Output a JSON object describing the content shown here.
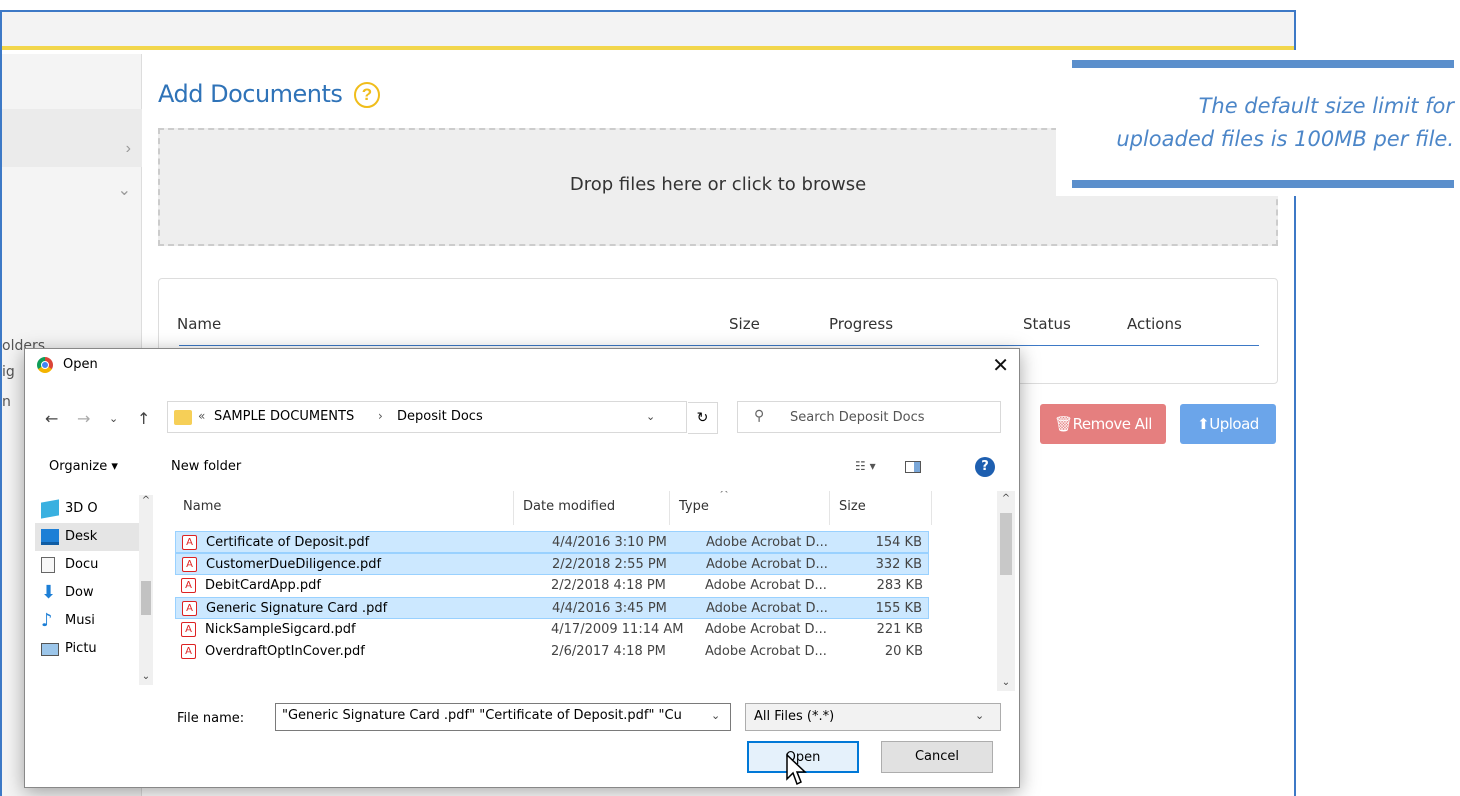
{
  "web": {
    "title": "Add Documents",
    "help_glyph": "?",
    "dropzone_text": "Drop files here or click to browse",
    "columns": [
      "Name",
      "Size",
      "Progress",
      "Status",
      "Actions"
    ],
    "remove_all_label": "Remove All",
    "upload_label": "Upload",
    "nav_partial": [
      "olders",
      "ig",
      "n"
    ],
    "accent_color": "#2f73b8",
    "highlight_color": "#f2d64b"
  },
  "callout": {
    "text_line1": "The default size limit for",
    "text_line2": "uploaded files is 100MB per file."
  },
  "dialog": {
    "title": "Open",
    "breadcrumb": [
      "SAMPLE DOCUMENTS",
      "Deposit Docs"
    ],
    "breadcrumb_prefix": "«",
    "search_placeholder": "Search Deposit Docs",
    "organize_label": "Organize ▾",
    "new_folder_label": "New folder",
    "nav_pane": [
      {
        "label": "3D O",
        "icon": "3d-objects-icon"
      },
      {
        "label": "Desk",
        "icon": "desktop-icon"
      },
      {
        "label": "Docu",
        "icon": "documents-icon"
      },
      {
        "label": "Dow",
        "icon": "downloads-icon"
      },
      {
        "label": "Musi",
        "icon": "music-icon"
      },
      {
        "label": "Pictu",
        "icon": "pictures-icon"
      }
    ],
    "list_headers": {
      "name": "Name",
      "date": "Date modified",
      "type": "Type",
      "size": "Size"
    },
    "files": [
      {
        "name": "Certificate of Deposit.pdf",
        "date": "4/4/2016 3:10 PM",
        "type": "Adobe Acrobat D...",
        "size": "154 KB",
        "selected": true
      },
      {
        "name": "CustomerDueDiligence.pdf",
        "date": "2/2/2018 2:55 PM",
        "type": "Adobe Acrobat D...",
        "size": "332 KB",
        "selected": true
      },
      {
        "name": "DebitCardApp.pdf",
        "date": "2/2/2018 4:18 PM",
        "type": "Adobe Acrobat D...",
        "size": "283 KB",
        "selected": false
      },
      {
        "name": "Generic Signature Card .pdf",
        "date": "4/4/2016 3:45 PM",
        "type": "Adobe Acrobat D...",
        "size": "155 KB",
        "selected": true
      },
      {
        "name": "NickSampleSigcard.pdf",
        "date": "4/17/2009 11:14 AM",
        "type": "Adobe Acrobat D...",
        "size": "221 KB",
        "selected": false
      },
      {
        "name": "OverdraftOptInCover.pdf",
        "date": "2/6/2017 4:18 PM",
        "type": "Adobe Acrobat D...",
        "size": "20 KB",
        "selected": false
      }
    ],
    "filename_label": "File name:",
    "filename_value": "\"Generic Signature Card .pdf\" \"Certificate of Deposit.pdf\" \"Cu",
    "filetype_value": "All Files (*.*)",
    "open_label": "Open",
    "cancel_label": "Cancel"
  }
}
